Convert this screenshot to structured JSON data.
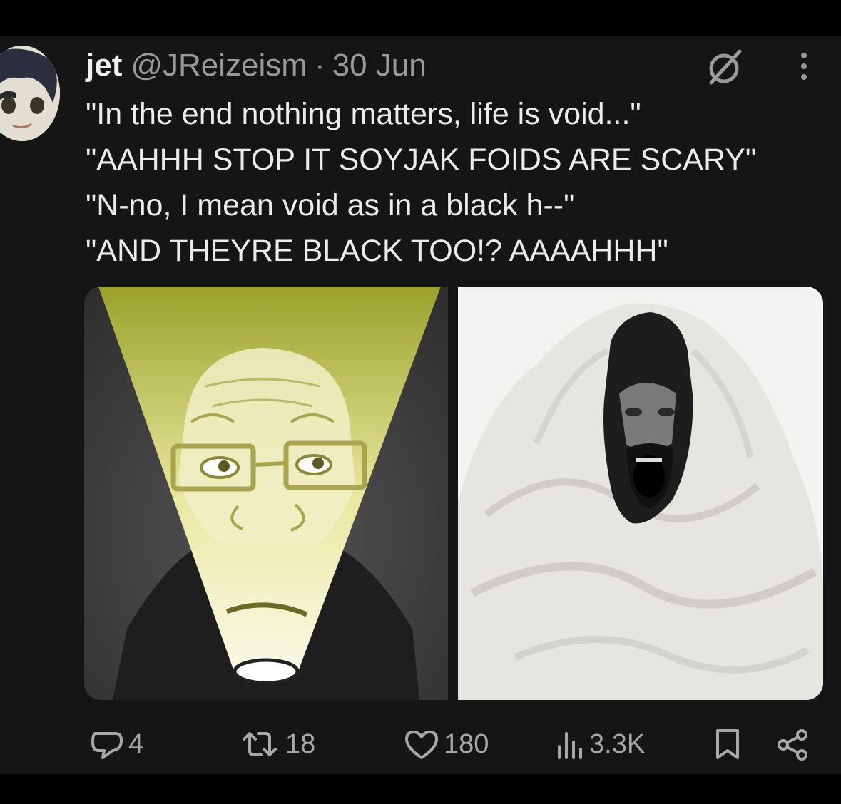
{
  "tweet": {
    "display_name": "jet",
    "handle": "@JReizeism",
    "separator": "·",
    "date": "30 Jun",
    "lines": [
      "\"In the end nothing matters, life is void...\"",
      "\"AAHHH STOP IT SOYJAK FOIDS ARE SCARY\"",
      "\"N-no, I mean void as in a black h--\"",
      "\"AND THEYRE BLACK TOO!? AAAAHHH\""
    ]
  },
  "media": {
    "left_image": "soyjak-with-flashlight-illustration",
    "right_image": "man-wrapped-in-white-blanket-screaming-photo"
  },
  "actions": {
    "replies": "4",
    "reposts": "18",
    "likes": "180",
    "views": "3.3K"
  },
  "icons": [
    "grok-icon",
    "more-icon",
    "reply-icon",
    "repost-icon",
    "like-icon",
    "views-icon",
    "bookmark-icon",
    "share-icon"
  ],
  "colors": {
    "background": "#151515",
    "text": "#e7e9ea",
    "muted": "#9a9a9a"
  }
}
